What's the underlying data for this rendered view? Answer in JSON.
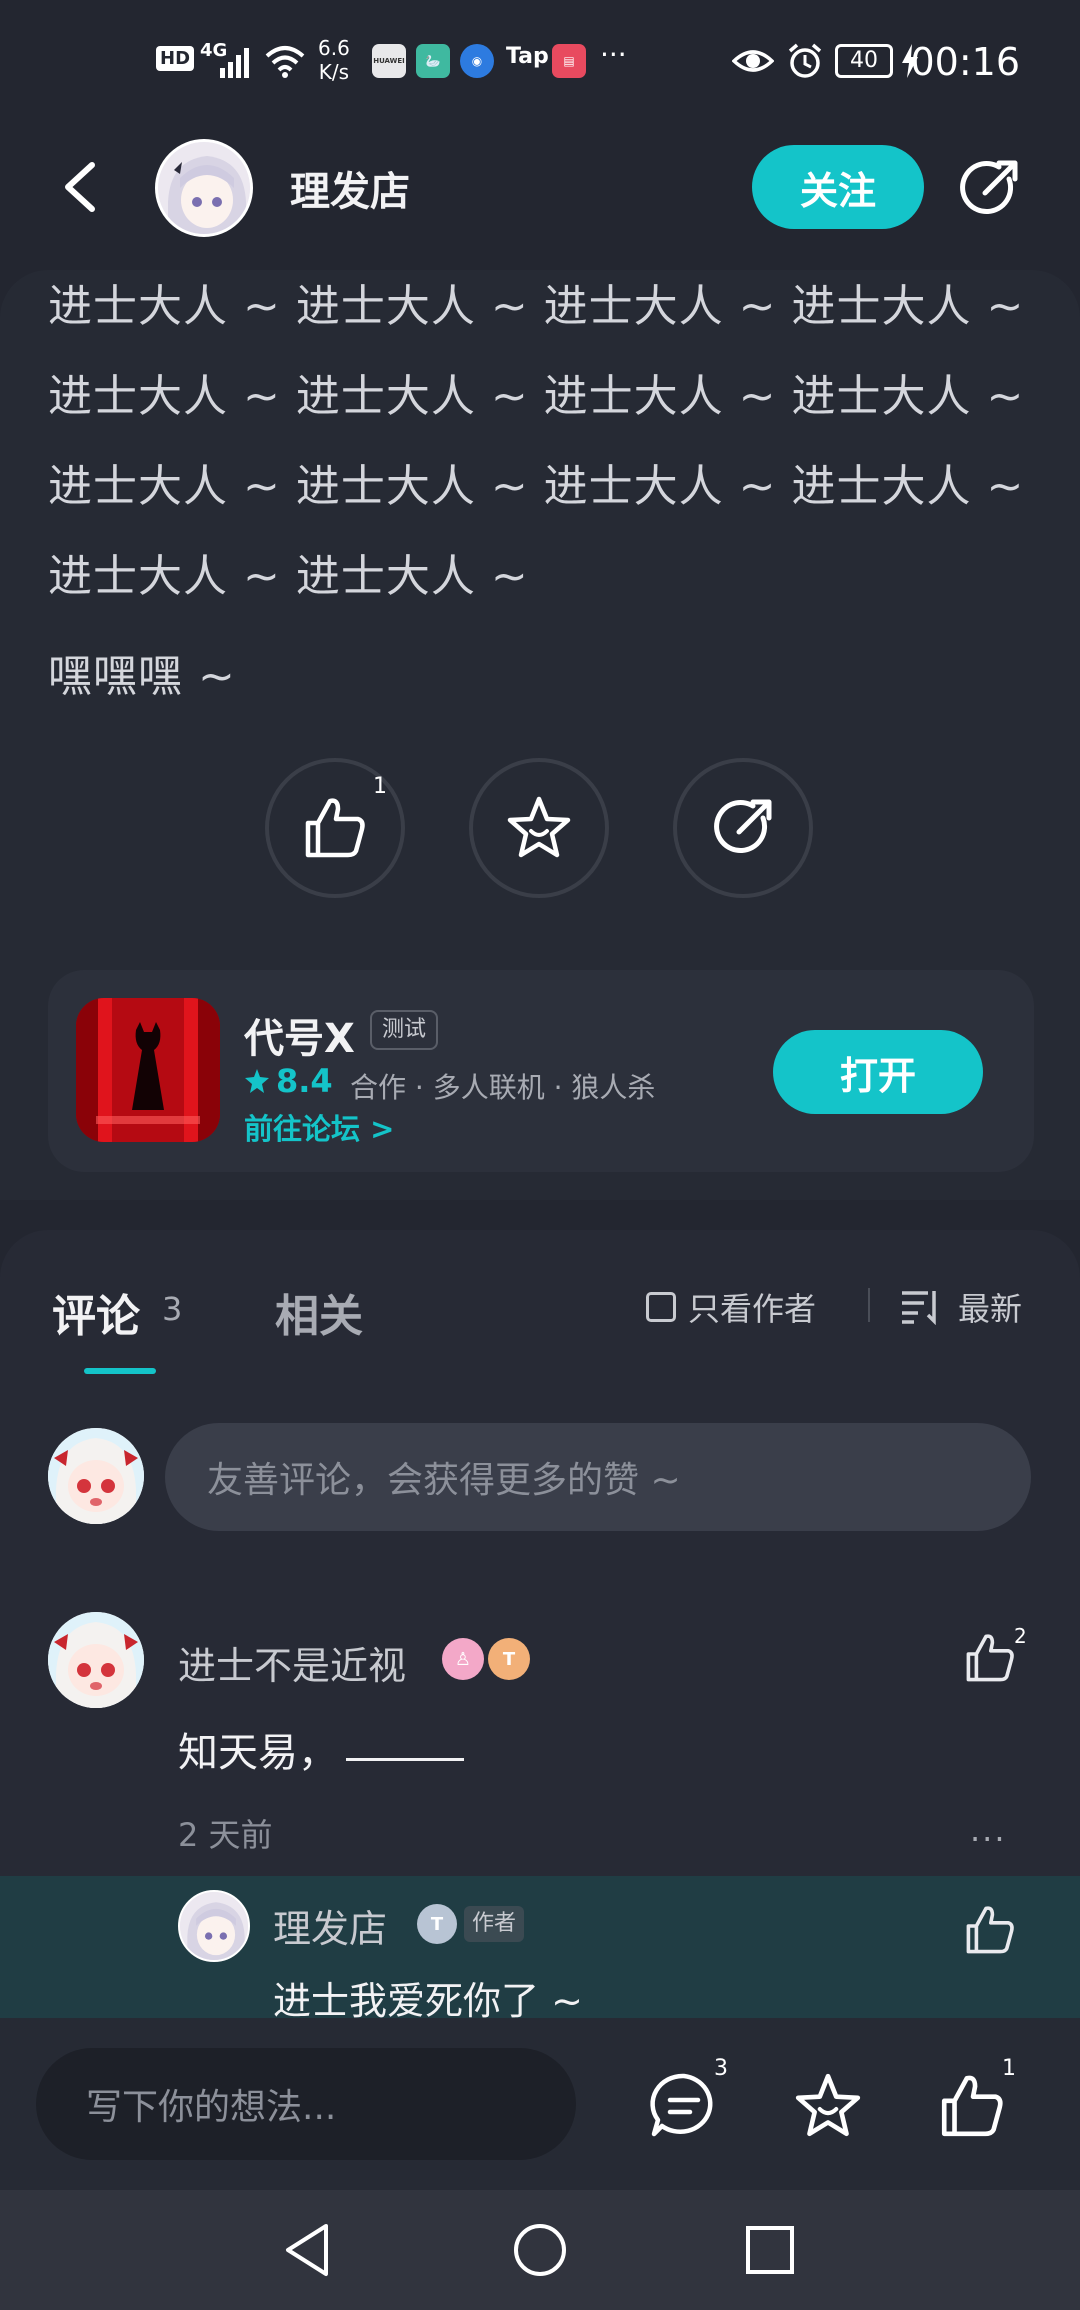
{
  "status_bar": {
    "hd": "HD",
    "network": "4G",
    "speed_value": "6.6",
    "speed_unit": "K/s",
    "app_huawei": "HUAWEI",
    "app_tap": "Tap",
    "more": "···",
    "battery": "40",
    "time": "00:16"
  },
  "header": {
    "author_name": "理发店",
    "follow_label": "关注"
  },
  "post": {
    "lines": [
      "进士大人 ~ 进士大人 ~ 进士大人 ~ 进士大人 ~",
      "进士大人 ~ 进士大人 ~ 进士大人 ~ 进士大人 ~",
      "进士大人 ~ 进士大人 ~ 进士大人 ~ 进士大人 ~",
      "进士大人 ~ 进士大人 ~",
      "嘿嘿嘿 ~"
    ],
    "like_count": "1"
  },
  "game": {
    "name": "代号X",
    "tag": "测试",
    "score": "8.4",
    "genre": "合作 · 多人联机 · 狼人杀",
    "forum_link": "前往论坛 >",
    "open_label": "打开"
  },
  "comments": {
    "tab_comments": "评论",
    "count": "3",
    "tab_related": "相关",
    "only_author": "只看作者",
    "sort_label": "最新",
    "input_placeholder": "友善评论，会获得更多的赞 ~",
    "items": [
      {
        "name": "进士不是近视",
        "text": "知天易，",
        "time": "2 天前",
        "like_count": "2",
        "more": "···",
        "reply": {
          "name": "理发店",
          "tag": "作者",
          "text": "进士我爱死你了 ~"
        }
      }
    ]
  },
  "bottom_bar": {
    "placeholder": "写下你的想法...",
    "comment_count": "3",
    "like_count": "1"
  },
  "colors": {
    "accent": "#14c4c9",
    "background": "#232630",
    "reply_bg": "#203d44"
  }
}
